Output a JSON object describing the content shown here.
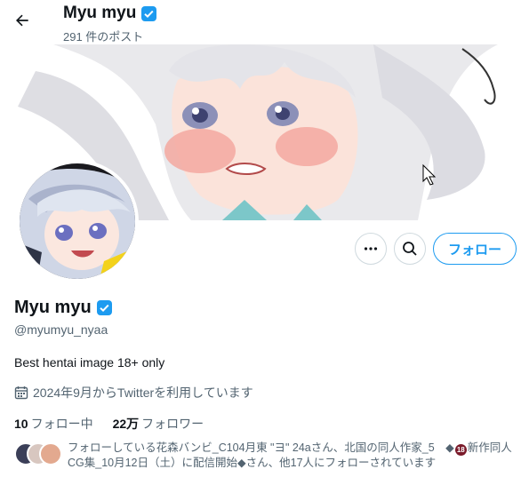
{
  "header": {
    "title": "Myu myu",
    "post_count": "291 件のポスト"
  },
  "profile": {
    "display_name": "Myu myu",
    "handle": "@myumyu_nyaa",
    "bio": "Best hentai image 18+ only",
    "joined": "2024年9月からTwitterを利用しています",
    "following_count": "10",
    "following_label": "フォロー中",
    "followers_count": "22万",
    "followers_label": "フォロワー",
    "followed_by_part1": "フォローしている花森バンビ_C104月東 \"ヨ\" 24aさん、北国の同人作家_5　◆",
    "badge": "18",
    "followed_by_part2": "新作同人CG集_10月12日（土）に配信開始◆さん、他17人にフォローされています"
  },
  "actions": {
    "follow_label": "フォロー",
    "more_icon": "more-horizontal-icon",
    "search_icon": "search-icon"
  },
  "colors": {
    "accent": "#1d9bf0",
    "text": "#0f1419",
    "muted": "#536471"
  }
}
